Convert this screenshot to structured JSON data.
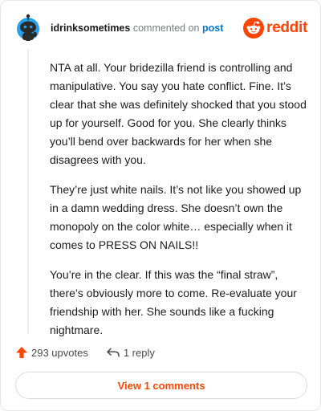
{
  "comment": {
    "username": "idrinksometimes",
    "commented_on_text": "commented on",
    "post_link_text": "post",
    "paragraphs": [
      "NTA at all. Your bridezilla friend is controlling and manipulative. You say you hate conflict. Fine. It’s clear that she was definitely shocked that you stood up for yourself. Good for you. She clearly thinks you’ll bend over backwards for her when she disagrees with you.",
      "They’re just white nails. It’s not like you showed up in a damn wedding dress. She doesn’t own the monopoly on the color white… especially when it comes to PRESS ON NAILS!!",
      "You’re in the clear. If this was the “final straw”, there’s obviously more to come. Re-evaluate your friendship with her. She sounds like a fucking nightmare."
    ]
  },
  "brand": {
    "wordmark": "reddit",
    "color": "#ff4500"
  },
  "actions": {
    "upvotes_label": "293 upvotes",
    "reply_label": "1 reply",
    "upvote_icon": "upvote-arrow-icon",
    "reply_icon": "reply-arrow-icon"
  },
  "view_comments_label": "View 1 comments",
  "colors": {
    "accent": "#ff4500",
    "link": "#0079d3",
    "avatar_bg": "#24a0ed",
    "avatar_mascot": "#2a2a2a"
  }
}
